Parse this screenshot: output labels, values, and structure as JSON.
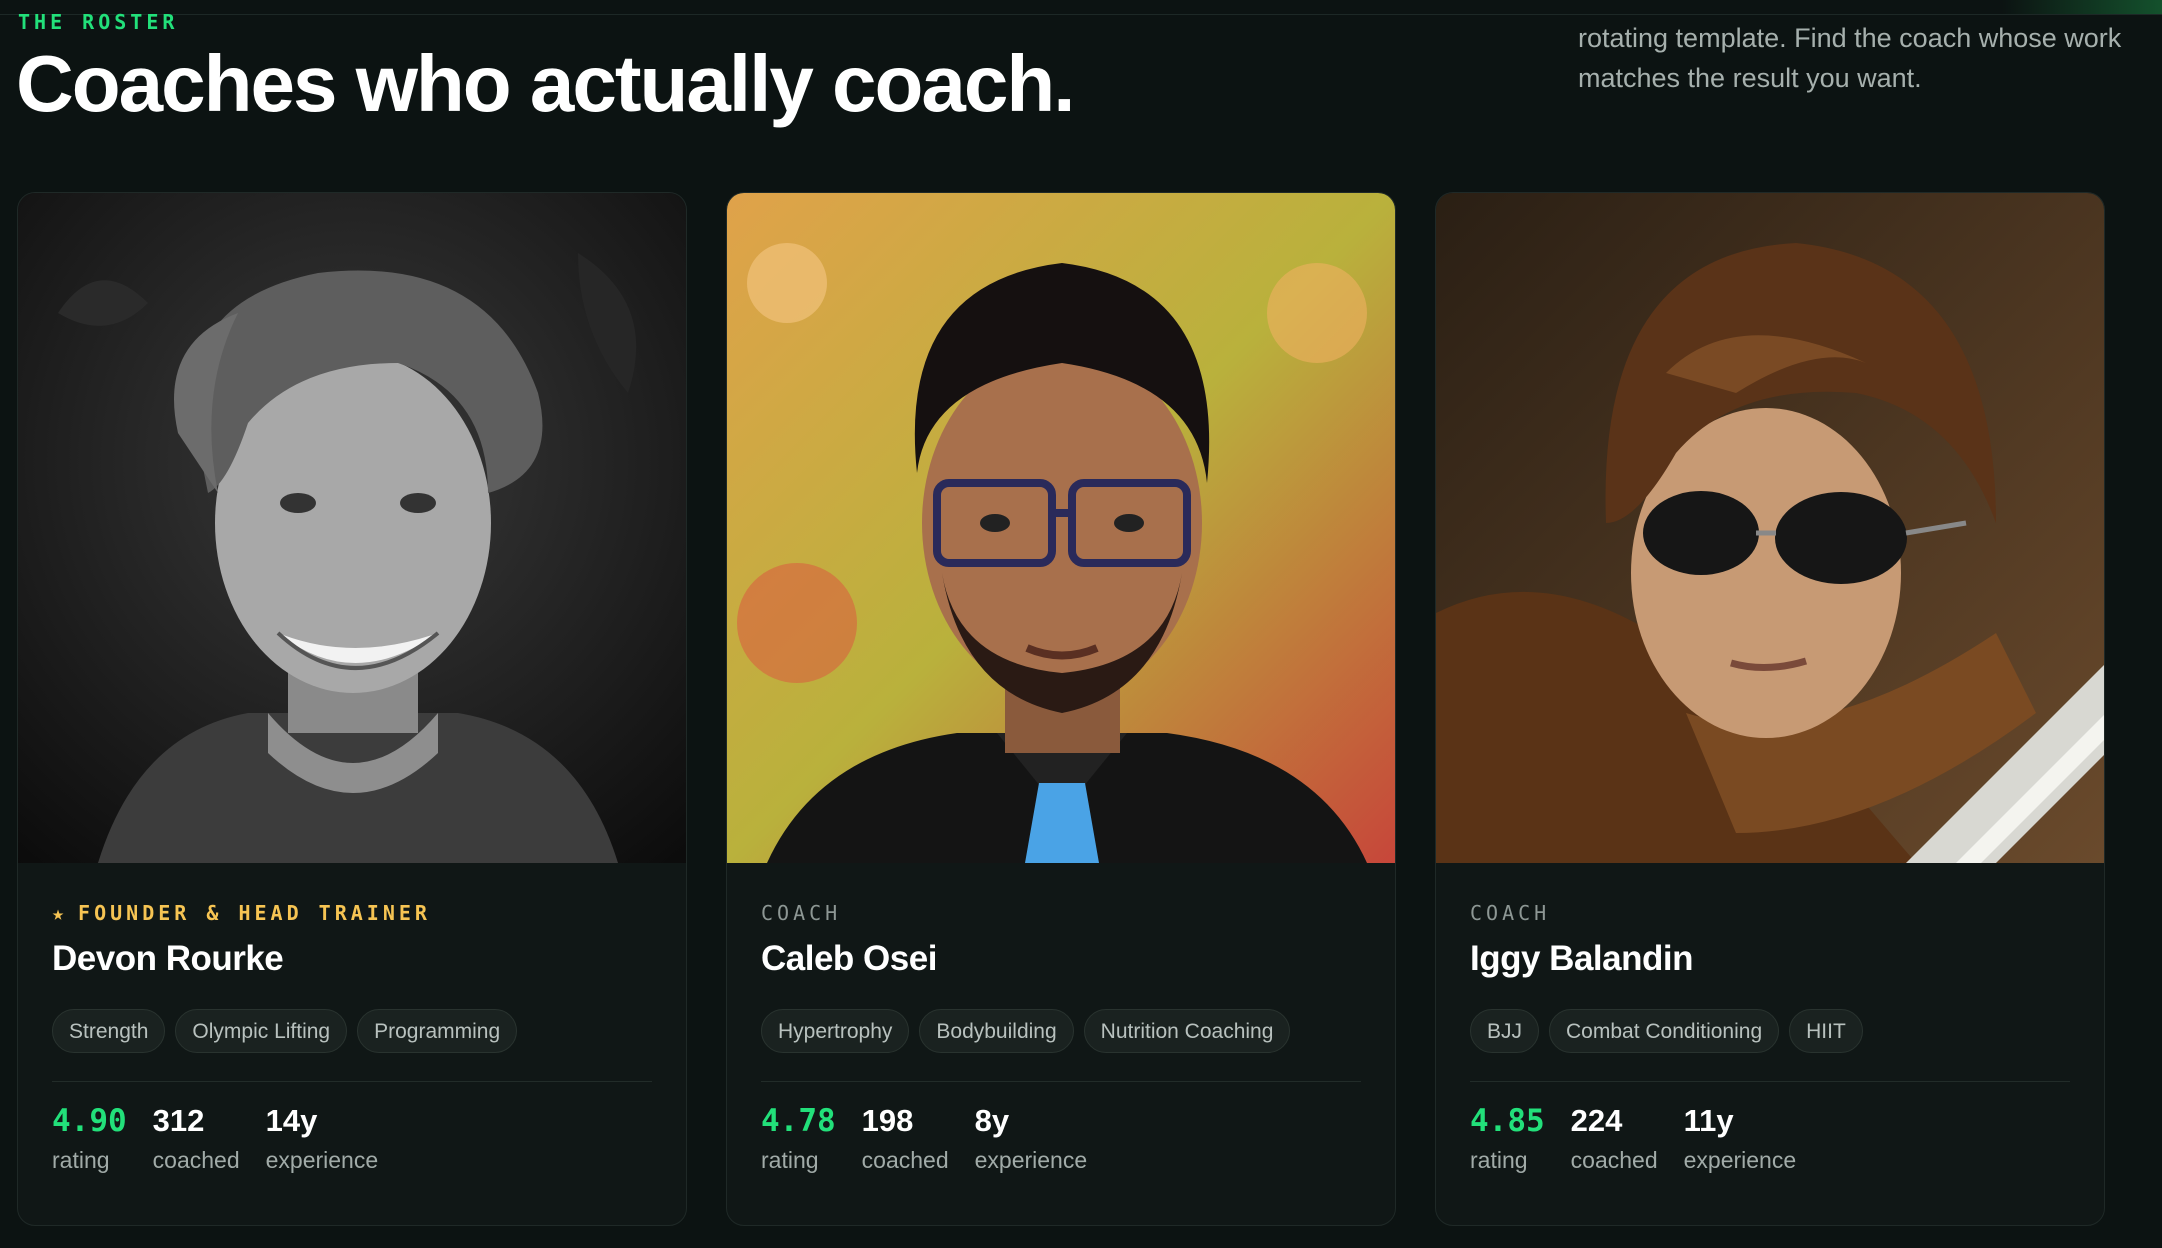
{
  "section": {
    "eyebrow": "THE ROSTER",
    "title": "Coaches who actually coach.",
    "intro": "rotating template. Find the coach whose work matches the result you want."
  },
  "colors": {
    "accent": "#22e07a",
    "founder": "#f6c453",
    "background": "#0c1312",
    "card": "#101716"
  },
  "coaches": [
    {
      "photo": "portrait-devon-rourke (black and white, smiling)",
      "role_icon": "star-icon",
      "role_star": "★",
      "role": "FOUNDER & HEAD TRAINER",
      "name": "Devon Rourke",
      "tags": [
        "Strength",
        "Olympic Lifting",
        "Programming"
      ],
      "stats": {
        "rating": "4.90",
        "rating_label": "rating",
        "coached": "312",
        "coached_label": "coached",
        "experience": "14y",
        "experience_label": "experience"
      }
    },
    {
      "photo": "portrait-caleb-osei (glasses, suit, blue tie)",
      "role": "COACH",
      "name": "Caleb Osei",
      "tags": [
        "Hypertrophy",
        "Bodybuilding",
        "Nutrition Coaching"
      ],
      "stats": {
        "rating": "4.78",
        "rating_label": "rating",
        "coached": "198",
        "coached_label": "coached",
        "experience": "8y",
        "experience_label": "experience"
      }
    },
    {
      "photo": "portrait-iggy-balandin (sunglasses, leather jacket, car)",
      "role": "COACH",
      "name": "Iggy Balandin",
      "tags": [
        "BJJ",
        "Combat Conditioning",
        "HIIT"
      ],
      "stats": {
        "rating": "4.85",
        "rating_label": "rating",
        "coached": "224",
        "coached_label": "coached",
        "experience": "11y",
        "experience_label": "experience"
      }
    }
  ]
}
